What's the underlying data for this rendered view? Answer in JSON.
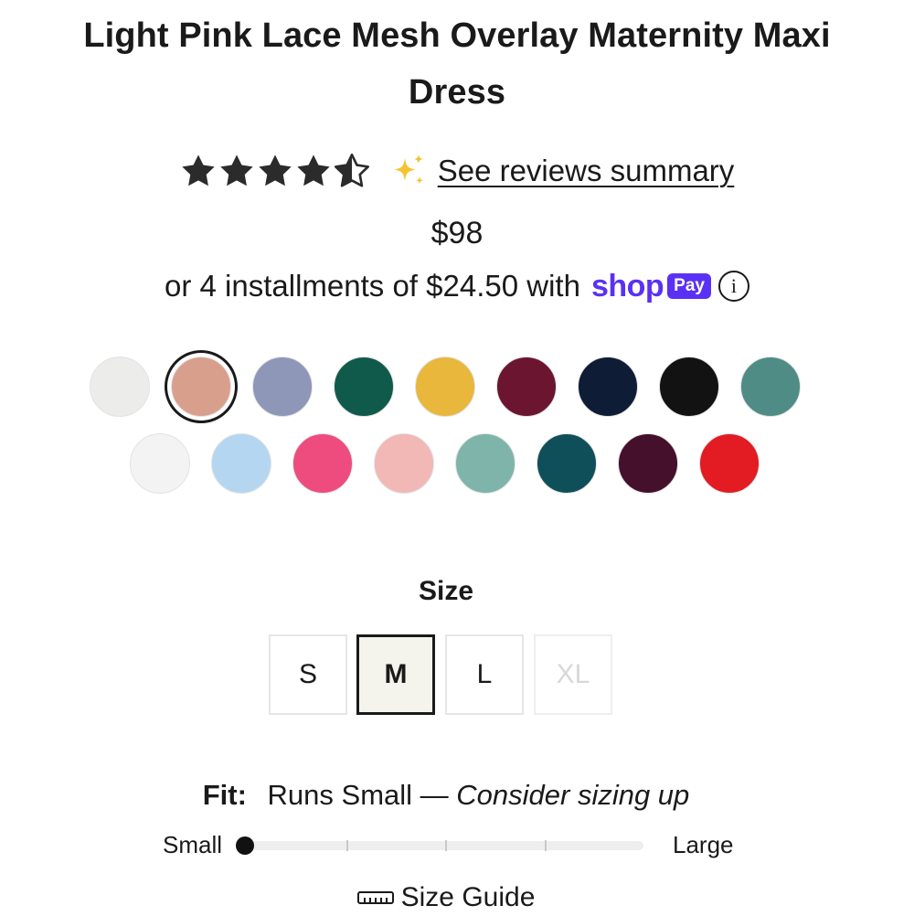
{
  "product": {
    "title_line1": "Light Pink Lace Mesh Overlay Maternity Maxi",
    "title_line2": "Dress",
    "rating": 4.5,
    "rating_max": 5,
    "reviews_link": "See reviews summary",
    "price": "$98",
    "installments_text": "or 4 installments of $24.50 with",
    "shop_word": "shop",
    "pay_badge": "Pay",
    "info_icon_glyph": "i"
  },
  "colors": {
    "star": "#2b2b2b",
    "sparkle": "#f4c430",
    "shop_pay": "#5a31f4",
    "selected_size_bg": "#f4f3ec"
  },
  "swatches": [
    {
      "color": "#ececea",
      "selected": false
    },
    {
      "color": "#d8a08c",
      "selected": true
    },
    {
      "color": "#8e97b8",
      "selected": false
    },
    {
      "color": "#0f5a4b",
      "selected": false
    },
    {
      "color": "#e8b73c",
      "selected": false
    },
    {
      "color": "#6b1531",
      "selected": false
    },
    {
      "color": "#0e1d35",
      "selected": false
    },
    {
      "color": "#121212",
      "selected": false
    },
    {
      "color": "#4f8c86",
      "selected": false
    },
    {
      "color": "#f3f3f3",
      "selected": false
    },
    {
      "color": "#b5d6f1",
      "selected": false
    },
    {
      "color": "#ee4c7e",
      "selected": false
    },
    {
      "color": "#f2b8b6",
      "selected": false
    },
    {
      "color": "#7fb4aa",
      "selected": false
    },
    {
      "color": "#0f4f5a",
      "selected": false
    },
    {
      "color": "#44102b",
      "selected": false
    },
    {
      "color": "#e31b23",
      "selected": false
    }
  ],
  "size": {
    "heading": "Size",
    "options": [
      {
        "label": "S",
        "selected": false,
        "disabled": false
      },
      {
        "label": "M",
        "selected": true,
        "disabled": false
      },
      {
        "label": "L",
        "selected": false,
        "disabled": false
      },
      {
        "label": "XL",
        "selected": false,
        "disabled": true
      }
    ]
  },
  "fit": {
    "label": "Fit:",
    "value": "Runs Small —",
    "advice": "Consider sizing up",
    "scale_min_label": "Small",
    "scale_max_label": "Large",
    "scale_level": 0
  },
  "size_guide": {
    "label": "Size Guide"
  }
}
